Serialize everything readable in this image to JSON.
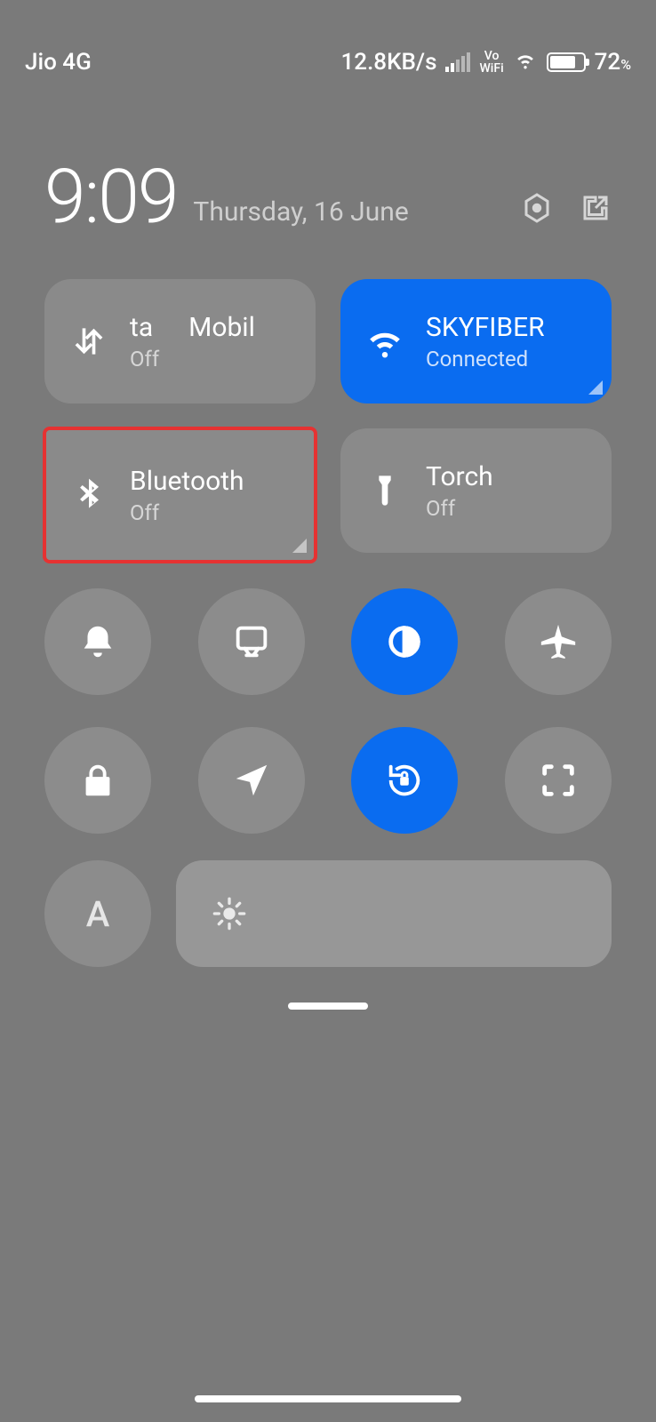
{
  "status": {
    "carrier": "Jio 4G",
    "data_rate": "12.8KB/s",
    "vowifi_top": "Vo",
    "vowifi_bottom": "WiFi",
    "battery_pct": "72",
    "battery_suffix": "%"
  },
  "header": {
    "time": "9:09",
    "date": "Thursday, 16 June"
  },
  "tiles": {
    "mobile_data": {
      "title_a": "ta",
      "title_b": "Mobil",
      "sub": "Off"
    },
    "wifi": {
      "title": "SKYFIBER",
      "sub": "Connected"
    },
    "bluetooth": {
      "title": "Bluetooth",
      "sub": "Off"
    },
    "torch": {
      "title": "Torch",
      "sub": "Off"
    }
  },
  "circles": {
    "row1": [
      "sound-icon",
      "screenshot-icon",
      "dark-mode-icon",
      "airplane-icon"
    ],
    "row2": [
      "lock-icon",
      "location-icon",
      "rotation-lock-icon",
      "scan-icon"
    ]
  },
  "brightness": {
    "auto_label": "A"
  },
  "colors": {
    "accent": "#0a6cf0",
    "highlight": "#e63232"
  }
}
